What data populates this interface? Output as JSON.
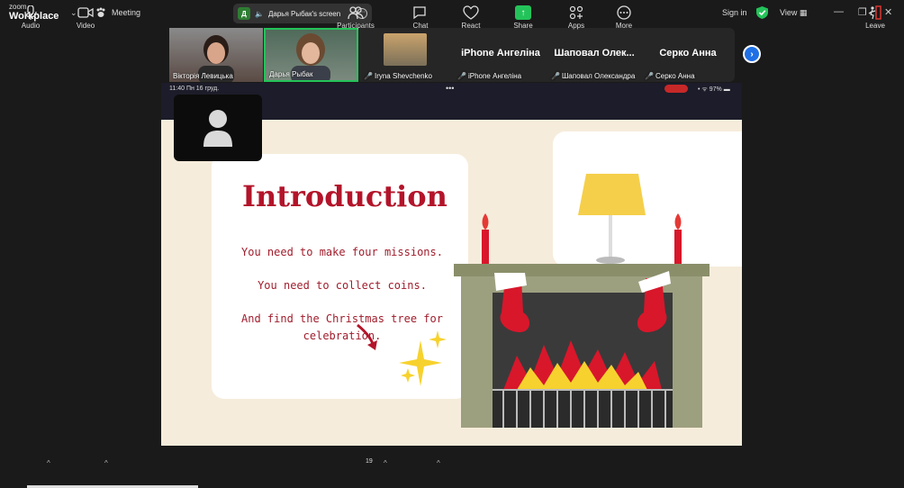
{
  "app": {
    "logo_line1": "zoom",
    "logo_line2": "Workplace",
    "meeting_label": "Meeting"
  },
  "screen_pill": {
    "initial": "Д",
    "label": "Дарья Рыбак's screen"
  },
  "header_right": {
    "sign_in": "Sign in",
    "view": "View"
  },
  "thumbnails": [
    {
      "name": "Вікторія Левицька",
      "muted": false,
      "active": false,
      "type": "video"
    },
    {
      "name": "Дарья Рыбак",
      "muted": false,
      "active": true,
      "type": "video"
    },
    {
      "name": "Iryna Shevchenko",
      "muted": true,
      "active": false,
      "type": "photo"
    },
    {
      "name": "iPhone Ангеліна",
      "display": "iPhone Ангеліна",
      "muted": true,
      "active": false,
      "type": "name"
    },
    {
      "name": "Шаповал Олександра",
      "display": "Шаповал Олек...",
      "muted": true,
      "active": false,
      "type": "name"
    },
    {
      "name": "Серко Анна",
      "display": "Серко Анна",
      "muted": true,
      "active": false,
      "type": "name"
    }
  ],
  "ios_status": {
    "time": "11:40 Пн 16 груд.",
    "battery": "97%"
  },
  "slide": {
    "title": "Introduction",
    "line1": "You need to make four missions.",
    "line2": "You need to collect coins.",
    "line3": "And find the Christmas tree for",
    "line4": "celebration."
  },
  "toolbar": {
    "audio": "Audio",
    "video": "Video",
    "participants": "Participants",
    "participants_count": "19",
    "chat": "Chat",
    "react": "React",
    "share": "Share",
    "apps": "Apps",
    "more": "More",
    "leave": "Leave"
  },
  "colors": {
    "accent_green": "#24c35a",
    "accent_blue": "#1f6fe5",
    "slide_red": "#b3142a",
    "leave_red": "#e53935"
  }
}
